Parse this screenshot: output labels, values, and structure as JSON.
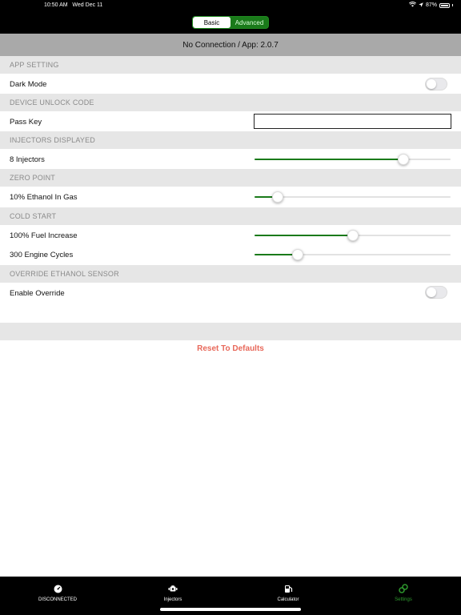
{
  "status_bar": {
    "time": "10:50 AM",
    "date": "Wed Dec 11",
    "battery": "87%"
  },
  "segmented_control": {
    "options": [
      "Basic",
      "Advanced"
    ],
    "selected": "Basic"
  },
  "connection_status": "No Connection / App: 2.0.7",
  "sections": {
    "app_setting": {
      "header": "APP SETTING",
      "dark_mode": {
        "label": "Dark Mode",
        "on": false
      }
    },
    "device_unlock": {
      "header": "DEVICE UNLOCK CODE",
      "pass_key": {
        "label": "Pass Key",
        "value": "",
        "placeholder": ""
      }
    },
    "injectors": {
      "header": "INJECTORS DISPLAYED",
      "label": "8 Injectors",
      "slider_fraction": 0.76
    },
    "zero_point": {
      "header": "ZERO POINT",
      "label": "10% Ethanol In Gas",
      "slider_fraction": 0.12
    },
    "cold_start": {
      "header": "COLD START",
      "fuel_increase": {
        "label": "100% Fuel Increase",
        "slider_fraction": 0.5
      },
      "engine_cycles": {
        "label": "300 Engine Cycles",
        "slider_fraction": 0.22
      }
    },
    "override": {
      "header": "OVERRIDE ETHANOL SENSOR",
      "enable": {
        "label": "Enable Override",
        "on": false
      }
    }
  },
  "reset_label": "Reset To Defaults",
  "colors": {
    "accent": "#1a7a1a",
    "reset": "#e8685a",
    "section_bg": "#e6e6e6"
  },
  "tabs": [
    {
      "label": "DISCONNECTED",
      "icon": "gauge-icon",
      "selected": false
    },
    {
      "label": "Injectors",
      "icon": "engine-icon",
      "selected": false
    },
    {
      "label": "Calculator",
      "icon": "fuel-pump-icon",
      "selected": false
    },
    {
      "label": "Settings",
      "icon": "settings-link-icon",
      "selected": true
    }
  ]
}
